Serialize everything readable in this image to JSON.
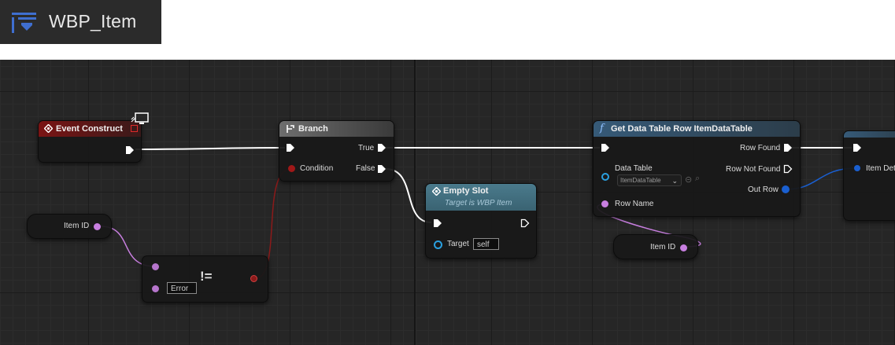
{
  "tab": {
    "title": "WBP_Item"
  },
  "nodes": {
    "event_construct": {
      "title": "Event Construct"
    },
    "branch": {
      "title": "Branch",
      "condition_label": "Condition",
      "true_label": "True",
      "false_label": "False"
    },
    "empty_slot": {
      "title": "Empty Slot",
      "subtitle": "Target is WBP Item",
      "target_label": "Target",
      "target_value": "self"
    },
    "get_row": {
      "title": "Get Data Table Row ItemDataTable",
      "data_table_label": "Data Table",
      "data_table_value": "ItemDataTable",
      "row_name_label": "Row Name",
      "row_found_label": "Row Found",
      "row_not_found_label": "Row Not Found",
      "out_row_label": "Out Row"
    },
    "item_id_1": {
      "label": "Item ID"
    },
    "item_id_2": {
      "label": "Item ID"
    },
    "not_equal": {
      "symbol": "!=",
      "value": "Error"
    },
    "partial_node": {
      "label": "Item Det"
    }
  },
  "colors": {
    "exec_wire": "#ffffff",
    "string_pin": "#c87fe0",
    "bool_pin": "#8b1a1a",
    "struct_pin": "#1a5fd0",
    "object_pin": "#2aa0e0"
  }
}
